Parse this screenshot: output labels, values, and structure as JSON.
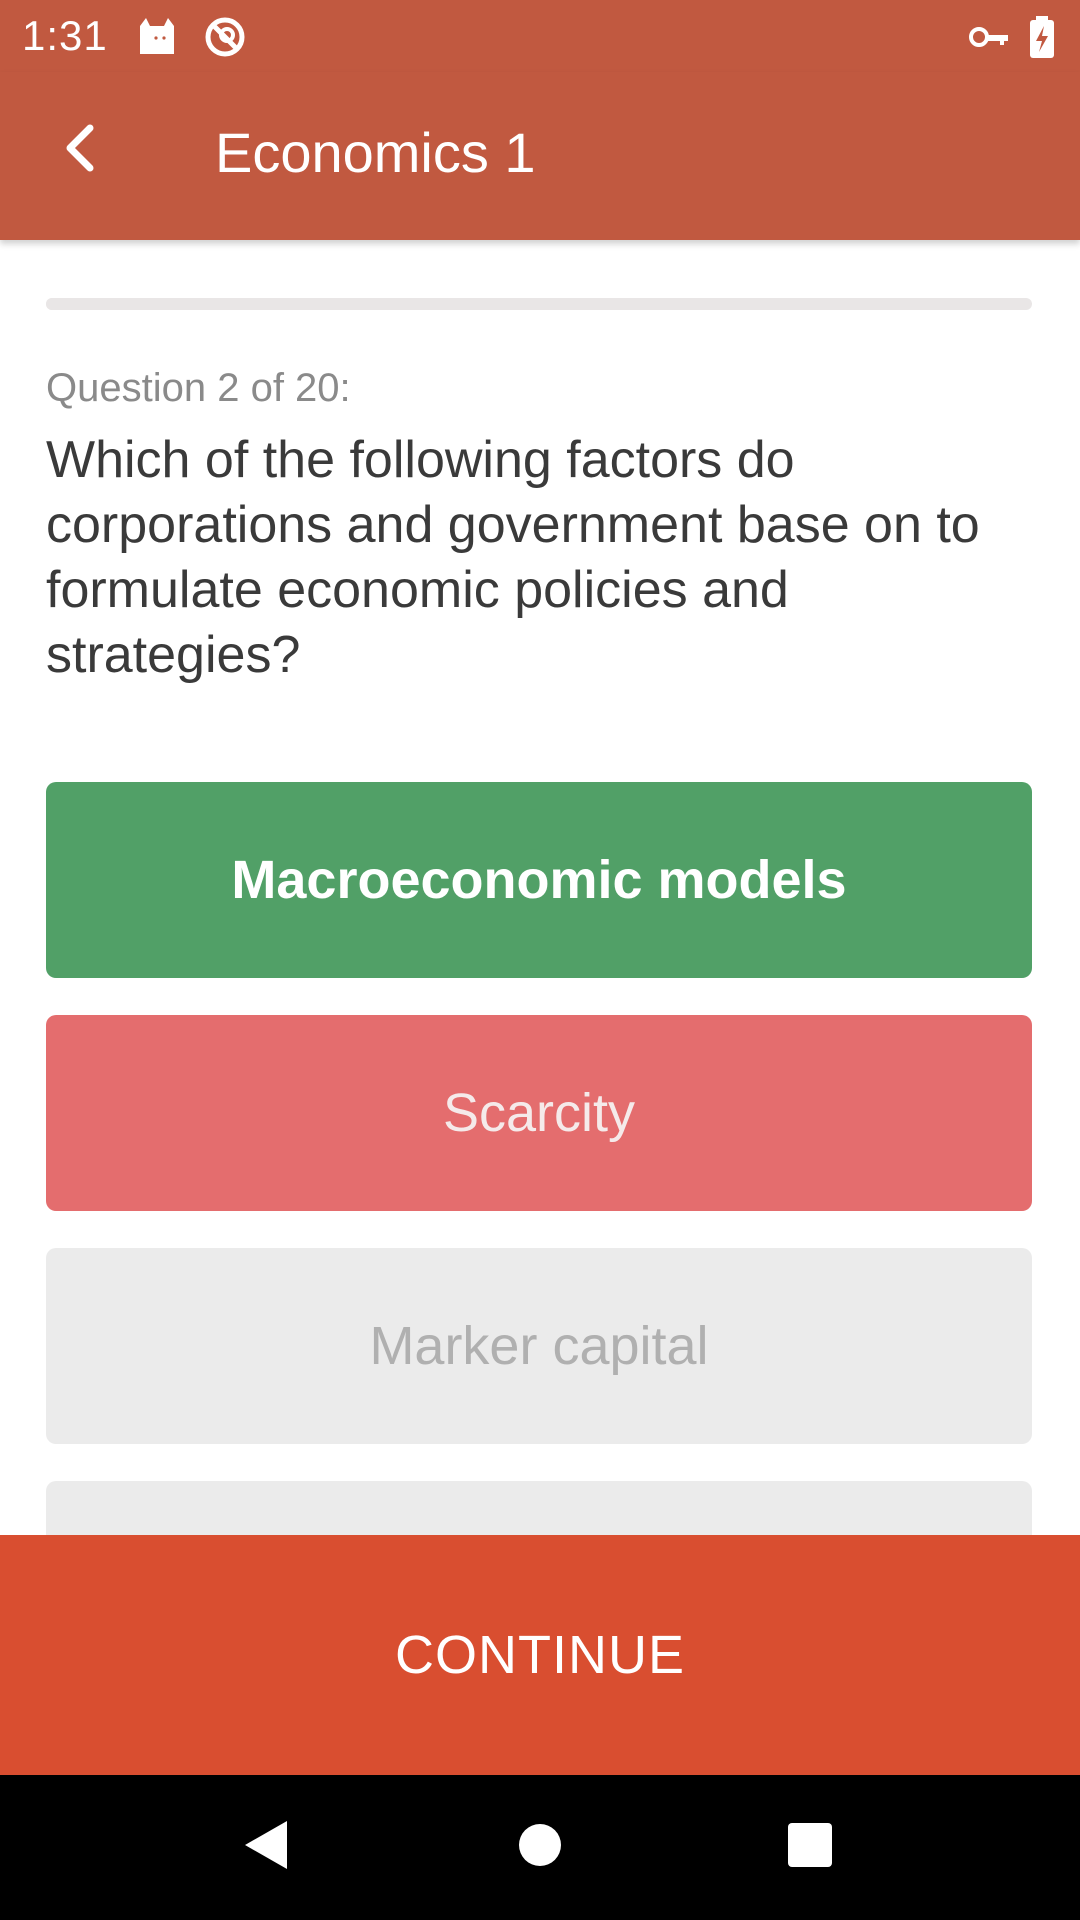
{
  "status_bar": {
    "time": "1:31",
    "icons": [
      "cat-notification-icon",
      "no-sync-icon",
      "vpn-key-icon",
      "battery-charging-icon"
    ]
  },
  "app_bar": {
    "title": "Economics 1",
    "back_icon": "chevron-left-icon"
  },
  "quiz": {
    "progress": 0.05,
    "question_counter": "Question 2 of 20:",
    "question_text": "Which of the following factors do corporations and government base on to formulate economic policies and strategies?",
    "answers": [
      {
        "label": "Macroeconomic models",
        "state": "correct"
      },
      {
        "label": "Scarcity",
        "state": "wrong"
      },
      {
        "label": "Marker capital",
        "state": "neutral"
      },
      {
        "label": "",
        "state": "neutral"
      }
    ]
  },
  "continue_label": "CONTINUE",
  "nav_bar": {
    "icons": [
      "back-triangle-icon",
      "home-circle-icon",
      "recents-square-icon"
    ]
  },
  "colors": {
    "app_bar": "#c15940",
    "correct": "#51a067",
    "wrong": "#e46d6e",
    "neutral": "#ebebeb",
    "continue": "#d94e30"
  }
}
